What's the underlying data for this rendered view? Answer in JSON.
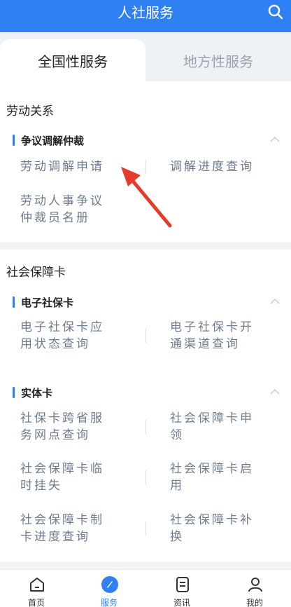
{
  "header": {
    "title": "人社服务",
    "search_icon": "search-icon"
  },
  "tabs": [
    {
      "label": "全国性服务",
      "active": true
    },
    {
      "label": "地方性服务",
      "active": false
    }
  ],
  "sections": {
    "labor": {
      "title": "劳动关系",
      "sub": "争议调解仲裁",
      "items": [
        "劳动调解申请",
        "调解进度查询",
        "劳动人事争议",
        "仲裁员名册"
      ]
    },
    "card": {
      "title": "社会保障卡",
      "sub1": "电子社保卡",
      "items1": [
        "电子社保卡应",
        "用状态查询",
        "电子社保卡开",
        "通渠道查询"
      ],
      "sub2": "实体卡",
      "items2": [
        "社保卡跨省服",
        "务网点查询",
        "社会保障卡申",
        "领",
        "社会保障卡临",
        "时挂失",
        "社会保障卡启",
        "用",
        "社会保障卡制",
        "卡进度查询",
        "社会保障卡补",
        "换"
      ]
    }
  },
  "nav": [
    {
      "label": "首页",
      "icon": "home-icon",
      "active": false
    },
    {
      "label": "服务",
      "icon": "compass-icon",
      "active": true
    },
    {
      "label": "资讯",
      "icon": "news-icon",
      "active": false
    },
    {
      "label": "我的",
      "icon": "user-icon",
      "active": false
    }
  ],
  "colors": {
    "primary": "#2f7ff5",
    "text_secondary": "#6e7c8f",
    "annotation_arrow": "#e53b2c"
  }
}
